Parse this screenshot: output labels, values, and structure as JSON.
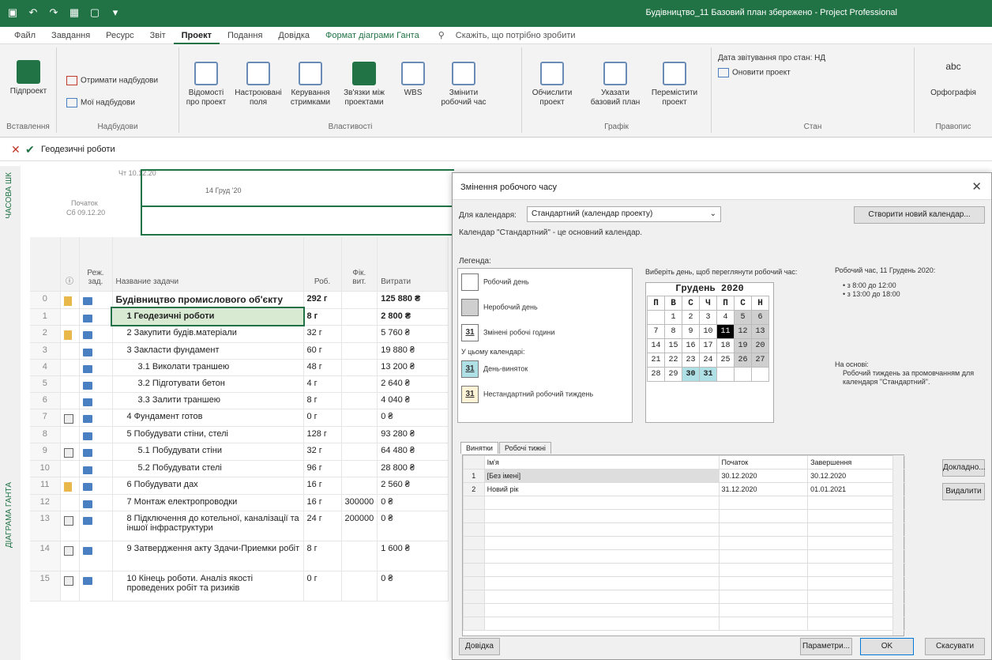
{
  "window": {
    "title": "Будівництво_11 Базовий план збережено - Project Professional"
  },
  "tabs": [
    "Файл",
    "Завдання",
    "Ресурс",
    "Звіт",
    "Проект",
    "Подання",
    "Довідка",
    "Формат діаграми Ганта"
  ],
  "tell_me": "Скажіть, що потрібно зробити",
  "ribbon": {
    "insert": {
      "subproject": "Підпроект",
      "group": "Вставлення"
    },
    "addins": {
      "get_addins": "Отримати надбудови",
      "my_addins": "Мої надбудови",
      "group": "Надбудови"
    },
    "properties": {
      "info": "Відомості про проект",
      "fields": "Настроювані поля",
      "manage": "Керування стримками",
      "links": "Зв'язки між проектами",
      "wbs": "WBS",
      "change_time": "Змінити робочий час",
      "group": "Властивості"
    },
    "schedule": {
      "calc": "Обчислити проект",
      "baseline": "Указати базовий план",
      "move": "Перемістити проект",
      "group": "Графік"
    },
    "status": {
      "status_date": "Дата звітування про стан:",
      "status_value": "НД",
      "update": "Оновити проект",
      "group": "Стан"
    },
    "proofing": {
      "spelling": "Орфографія",
      "group": "Правопис"
    }
  },
  "formula": {
    "value": "Геодезичні роботи"
  },
  "timeline": {
    "side_label": "ЧАСОВА ШК",
    "date_start": "Чт 10.12.20",
    "start_label": "Початок",
    "start_date": "Сб 09.12.20",
    "mid_date": "14 Груд '20"
  },
  "gantt": {
    "side_label": "ДІАГРАМА ГАНТА",
    "headers": {
      "mode": "Реж. зад.",
      "name": "Название задачи",
      "dur": "Роб.",
      "fix": "Фік. вит.",
      "cost": "Витрати"
    },
    "rows": [
      {
        "id": "0",
        "name": "Будівництво промислового об'єкту",
        "dur": "292 г",
        "fix": "",
        "cost": "125 880 ₴",
        "bold": true,
        "indent": 0
      },
      {
        "id": "1",
        "name": "1 Геодезичні роботи",
        "dur": "8 г",
        "fix": "",
        "cost": "2 800 ₴",
        "bold": true,
        "indent": 1
      },
      {
        "id": "2",
        "name": "2 Закупити будів.матеріали",
        "dur": "32 г",
        "fix": "",
        "cost": "5 760 ₴",
        "bold": false,
        "indent": 1
      },
      {
        "id": "3",
        "name": "3 Закласти фундамент",
        "dur": "60 г",
        "fix": "",
        "cost": "19 880 ₴",
        "bold": false,
        "indent": 1
      },
      {
        "id": "4",
        "name": "3.1 Виколати траншею",
        "dur": "48 г",
        "fix": "",
        "cost": "13 200 ₴",
        "bold": false,
        "indent": 2
      },
      {
        "id": "5",
        "name": "3.2 Підготувати бетон",
        "dur": "4 г",
        "fix": "",
        "cost": "2 640 ₴",
        "bold": false,
        "indent": 2
      },
      {
        "id": "6",
        "name": "3.3 Залити траншею",
        "dur": "8 г",
        "fix": "",
        "cost": "4 040 ₴",
        "bold": false,
        "indent": 2
      },
      {
        "id": "7",
        "name": "4 Фундамент готов",
        "dur": "0 г",
        "fix": "",
        "cost": "0 ₴",
        "bold": false,
        "indent": 1
      },
      {
        "id": "8",
        "name": "5 Побудувати стіни, стелі",
        "dur": "128 г",
        "fix": "",
        "cost": "93 280 ₴",
        "bold": false,
        "indent": 1
      },
      {
        "id": "9",
        "name": "5.1 Побудувати стіни",
        "dur": "32 г",
        "fix": "",
        "cost": "64 480 ₴",
        "bold": false,
        "indent": 2
      },
      {
        "id": "10",
        "name": "5.2 Побудувати стелі",
        "dur": "96 г",
        "fix": "",
        "cost": "28 800 ₴",
        "bold": false,
        "indent": 2
      },
      {
        "id": "11",
        "name": "6 Побудувати дах",
        "dur": "16 г",
        "fix": "",
        "cost": "2 560 ₴",
        "bold": false,
        "indent": 1
      },
      {
        "id": "12",
        "name": "7 Монтаж електропроводки",
        "dur": "16 г",
        "fix": "300000",
        "cost": "0 ₴",
        "bold": false,
        "indent": 1
      },
      {
        "id": "13",
        "name": "8 Підключення до котельної, каналізації та іншої інфраструктури",
        "dur": "24 г",
        "fix": "200000",
        "cost": "0 ₴",
        "bold": false,
        "indent": 1
      },
      {
        "id": "14",
        "name": "9 Затвердження акту Здачи-Приемки робіт",
        "dur": "8 г",
        "fix": "",
        "cost": "1 600 ₴",
        "bold": false,
        "indent": 1
      },
      {
        "id": "15",
        "name": "10 Кінець роботи. Аналіз якості проведених робіт та ризиків",
        "dur": "0 г",
        "fix": "",
        "cost": "0 ₴",
        "bold": false,
        "indent": 1
      }
    ]
  },
  "dialog": {
    "title": "Змінення робочого часу",
    "for_calendar_label": "Для календаря:",
    "calendar_value": "Стандартний (календар проекту)",
    "create_new": "Створити новий календар...",
    "base_info": "Календар \"Стандартний\" - це основний календар.",
    "legend_title": "Легенда:",
    "legend": {
      "work_day": "Робочий день",
      "nonwork_day": "Неробочий день",
      "changed_hours": "Змінені робочі години",
      "in_calendar": "У цьому календарі:",
      "exception_day": "День-виняток",
      "nondefault_week": "Нестандартний робочий тиждень"
    },
    "pick_day": "Виберіть день, щоб переглянути робочий час:",
    "month": "Грудень 2020",
    "weekdays": [
      "П",
      "В",
      "С",
      "Ч",
      "П",
      "С",
      "Н"
    ],
    "weeks": [
      [
        "",
        "1",
        "2",
        "3",
        "4",
        "5",
        "6"
      ],
      [
        "7",
        "8",
        "9",
        "10",
        "11",
        "12",
        "13"
      ],
      [
        "14",
        "15",
        "16",
        "17",
        "18",
        "19",
        "20"
      ],
      [
        "21",
        "22",
        "23",
        "24",
        "25",
        "26",
        "27"
      ],
      [
        "28",
        "29",
        "30",
        "31",
        "",
        "",
        ""
      ]
    ],
    "work_time_title": "Робочий час, 11 Грудень 2020:",
    "work_times": [
      "• з 8:00 до 12:00",
      "• з 13:00 до 18:00"
    ],
    "based_on": "На основі:",
    "based_on_text": "Робочий тиждень за промовчанням для календаря \"Стандартний\".",
    "tabs": {
      "exceptions": "Винятки",
      "work_weeks": "Робочі тижні"
    },
    "exc_headers": {
      "name": "Ім'я",
      "start": "Початок",
      "end": "Завершення"
    },
    "exceptions": [
      {
        "n": "1",
        "name": "[Без імені]",
        "start": "30.12.2020",
        "end": "30.12.2020"
      },
      {
        "n": "2",
        "name": "Новий рік",
        "start": "31.12.2020",
        "end": "01.01.2021"
      }
    ],
    "details": "Докладно...",
    "delete": "Видалити",
    "help": "Довідка",
    "options": "Параметри...",
    "ok": "OK",
    "cancel": "Скасувати"
  }
}
